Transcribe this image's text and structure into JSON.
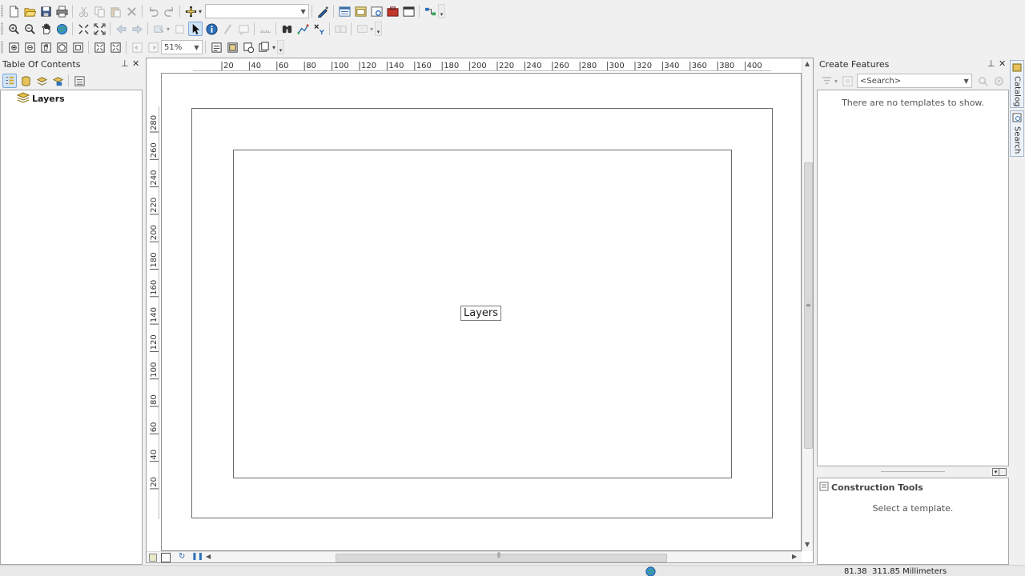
{
  "toolbar": {
    "scale_combo_value": "",
    "zoom_value": "51%"
  },
  "toc": {
    "title": "Table Of Contents",
    "layers_label": "Layers"
  },
  "layout": {
    "data_frame_label": "Layers",
    "hruler_ticks": [
      "20",
      "40",
      "60",
      "80",
      "100",
      "120",
      "140",
      "160",
      "180",
      "200",
      "220",
      "240",
      "260",
      "280",
      "300",
      "320",
      "340",
      "360",
      "380",
      "400"
    ],
    "vruler_ticks": [
      "280",
      "260",
      "240",
      "220",
      "200",
      "180",
      "160",
      "140",
      "120",
      "100",
      "80",
      "60",
      "40",
      "20"
    ]
  },
  "create_features": {
    "title": "Create Features",
    "search_placeholder": "<Search>",
    "empty_message": "There are no templates to show."
  },
  "construction_tools": {
    "title": "Construction Tools",
    "message": "Select a template."
  },
  "side_tabs": {
    "catalog": "Catalog",
    "search": "Search"
  },
  "status": {
    "coordinates": "81.38  311.85 Millimeters"
  },
  "colors": {
    "accent": "#3c7fc6",
    "selection_bg": "#cfe3f7"
  }
}
